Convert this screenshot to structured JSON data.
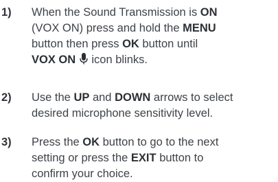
{
  "steps": [
    {
      "number": "1)",
      "lines": [
        {
          "t1": "When the Sound Transmission is ",
          "b1": "ON"
        },
        {
          "t1": "(VOX ON) press and hold the ",
          "b1": "MENU"
        },
        {
          "t1": "button then press ",
          "b1": "OK",
          "t2": " button until"
        },
        {
          "b1": "VOX ON",
          "icon": "microphone-icon",
          "t2": " icon blinks."
        }
      ]
    },
    {
      "number": "2)",
      "lines": [
        {
          "t1": "Use the ",
          "b1": "UP",
          "t2": " and ",
          "b2": "DOWN",
          "t3": " arrows to select"
        },
        {
          "t1": "desired microphone sensitivity level."
        }
      ]
    },
    {
      "number": "3)",
      "lines": [
        {
          "t1": "Press the ",
          "b1": "OK",
          "t2": " button to go to the next"
        },
        {
          "t1": "setting or press the ",
          "b1": "EXIT",
          "t2": " button to"
        },
        {
          "t1": "confirm your choice."
        }
      ]
    }
  ]
}
